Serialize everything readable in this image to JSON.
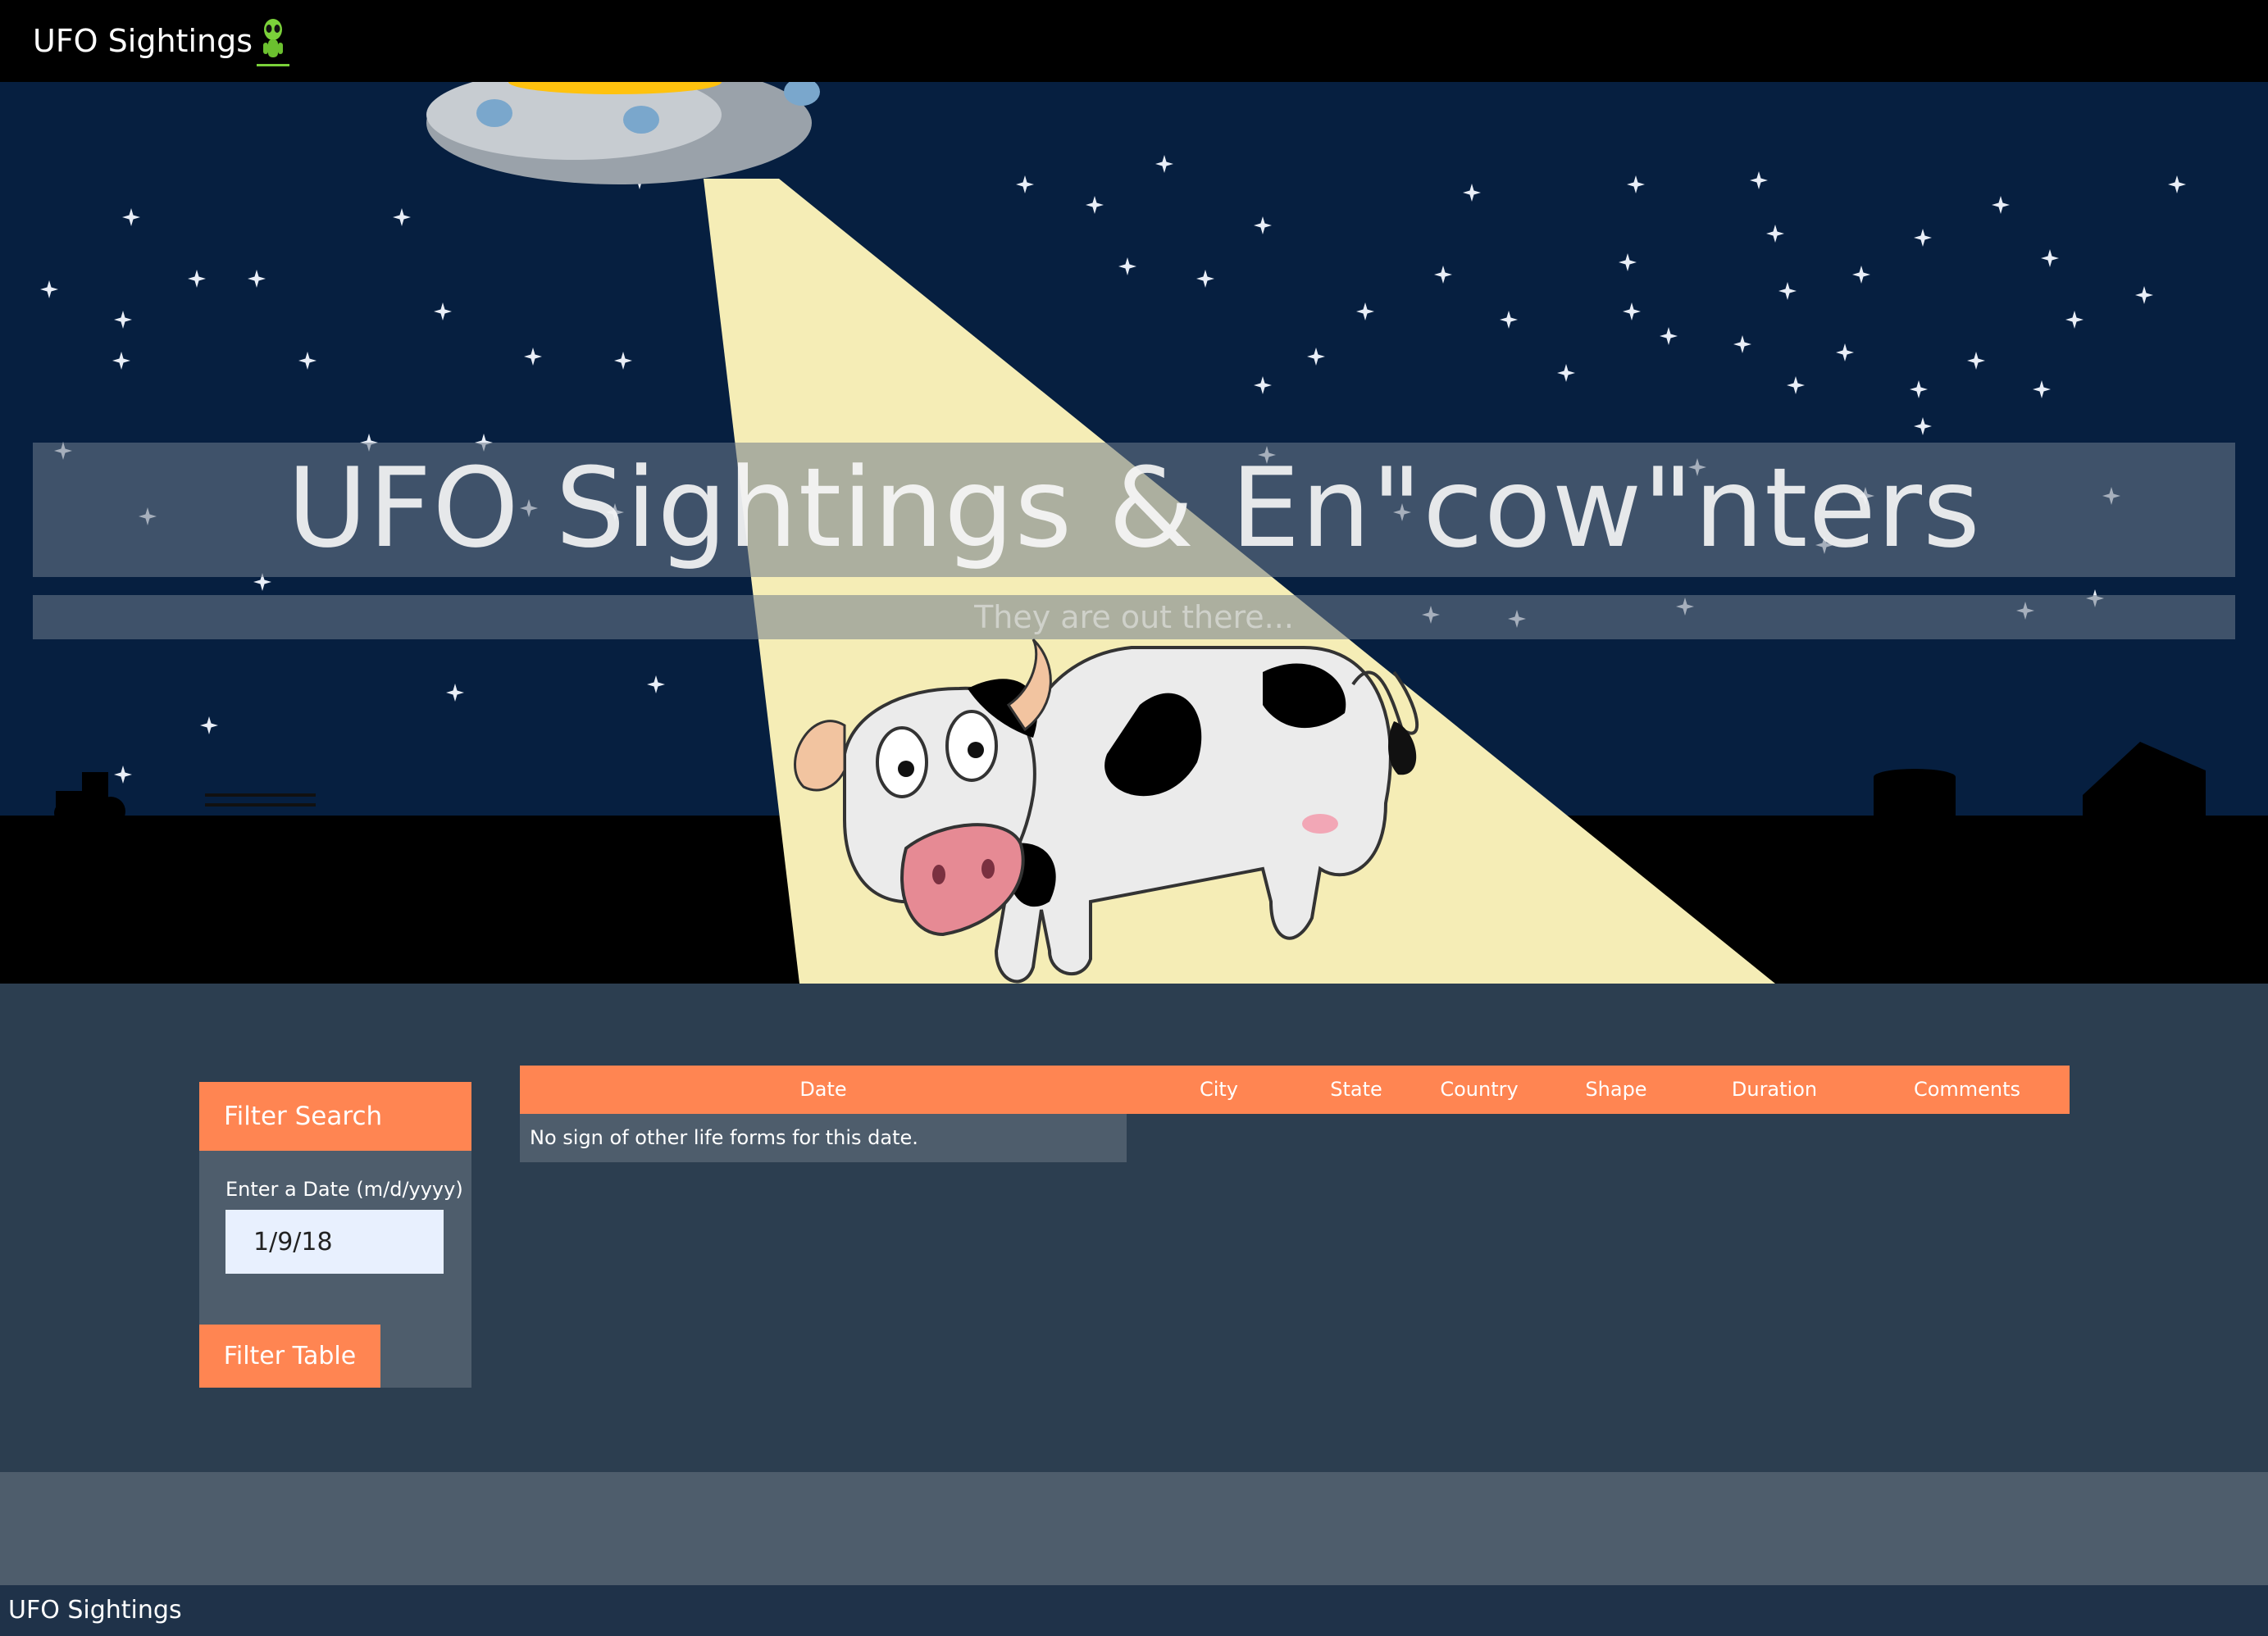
{
  "navbar": {
    "brand": "UFO Sightings",
    "brand_icon": "alien-icon"
  },
  "hero": {
    "title": "UFO Sightings & En\"cow\"nters",
    "subtitle": "They are out there...",
    "colors": {
      "sky": "#061f40",
      "beam": "#f5edb6",
      "ground": "#000000"
    }
  },
  "filter": {
    "header": "Filter Search",
    "date_label": "Enter a Date (m/d/yyyy)",
    "date_value": "1/9/18",
    "button_label": "Filter Table"
  },
  "table": {
    "columns": [
      "Date",
      "City",
      "State",
      "Country",
      "Shape",
      "Duration",
      "Comments"
    ],
    "empty_message": "No sign of other life forms for this date."
  },
  "footer": {
    "text": "UFO Sightings"
  },
  "colors": {
    "accent": "#ff8552",
    "page_bg": "#2c3e50",
    "panel_bg": "#4e5d6c",
    "footer_bar": "#1f3249"
  }
}
